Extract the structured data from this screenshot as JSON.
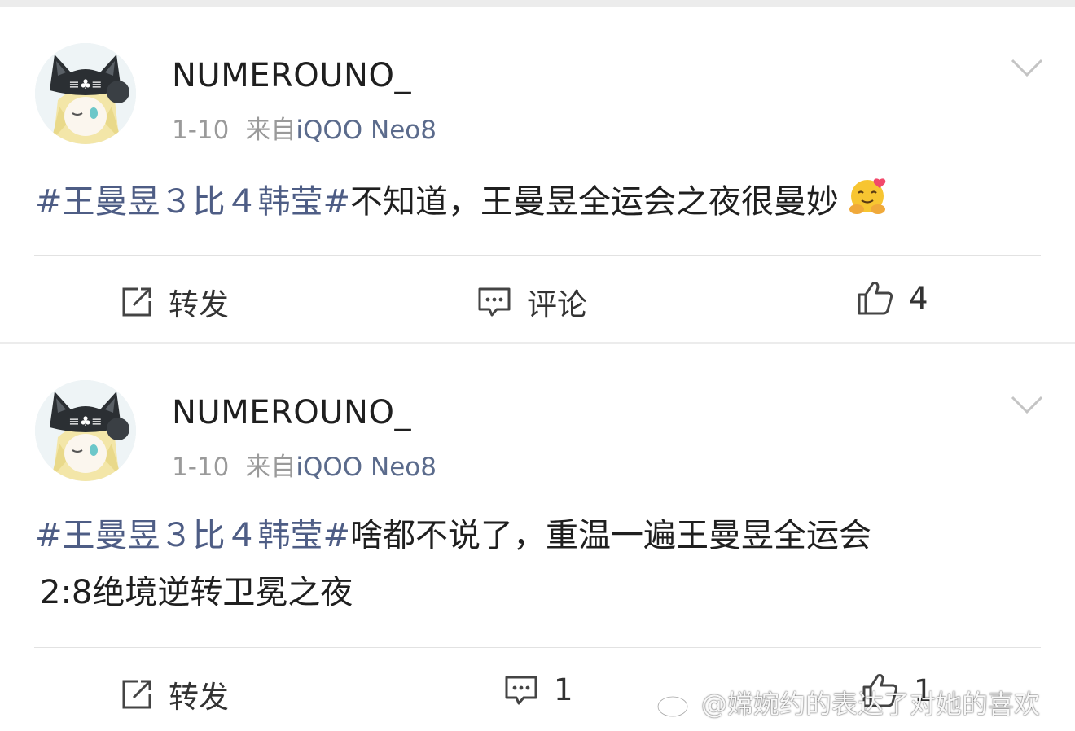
{
  "posts": [
    {
      "username": "NUMEROUNO_",
      "date": "1-10",
      "source_prefix": "来自",
      "device": "iQOO Neo8",
      "hashtag": "#王曼昱３比４韩莹#",
      "text": "不知道，王曼昱全运会之夜很曼妙",
      "text_line2": "",
      "emoji": "hug-emoji",
      "repost_label": "转发",
      "comment_label": "评论",
      "like_count": "4"
    },
    {
      "username": "NUMEROUNO_",
      "date": "1-10",
      "source_prefix": "来自",
      "device": "iQOO Neo8",
      "hashtag": "#王曼昱３比４韩莹#",
      "text": "啥都不说了，重温一遍王曼昱全运会",
      "text_line2": "2:8绝境逆转卫冕之夜",
      "repost_label": "转发",
      "comment_count": "1",
      "like_count": "1"
    }
  ],
  "watermark": {
    "text": "@嫦婉约的表达了对她的喜欢",
    "icon": "weibo-logo-icon"
  },
  "colors": {
    "hashtag": "#4e5d85",
    "source": "#5b6b8c",
    "meta": "#9a9a9a",
    "background": "#ececec"
  }
}
